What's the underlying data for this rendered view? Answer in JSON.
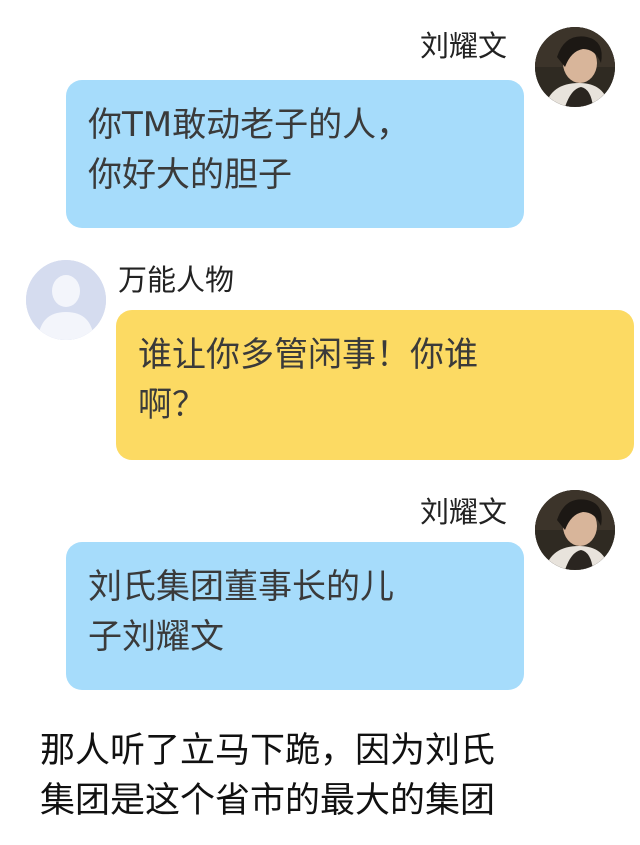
{
  "messages": [
    {
      "sender": "刘耀文",
      "side": "right",
      "bubble_color": "#a6dcfb",
      "avatar_icon": "portrait-photo-icon",
      "lines": [
        "你TM敢动老子的人，",
        "你好大的胆子"
      ]
    },
    {
      "sender": "万能人物",
      "side": "left",
      "bubble_color": "#fcda63",
      "avatar_icon": "default-user-icon",
      "lines": [
        "谁让你多管闲事！你谁",
        "啊？"
      ]
    },
    {
      "sender": "刘耀文",
      "side": "right",
      "bubble_color": "#a6dcfb",
      "avatar_icon": "portrait-photo-icon",
      "lines": [
        "刘氏集团董事长的儿",
        "子刘耀文"
      ]
    }
  ],
  "narration": {
    "lines": [
      "那人听了立马下跪，因为刘氏",
      "集团是这个省市的最大的集团"
    ]
  }
}
